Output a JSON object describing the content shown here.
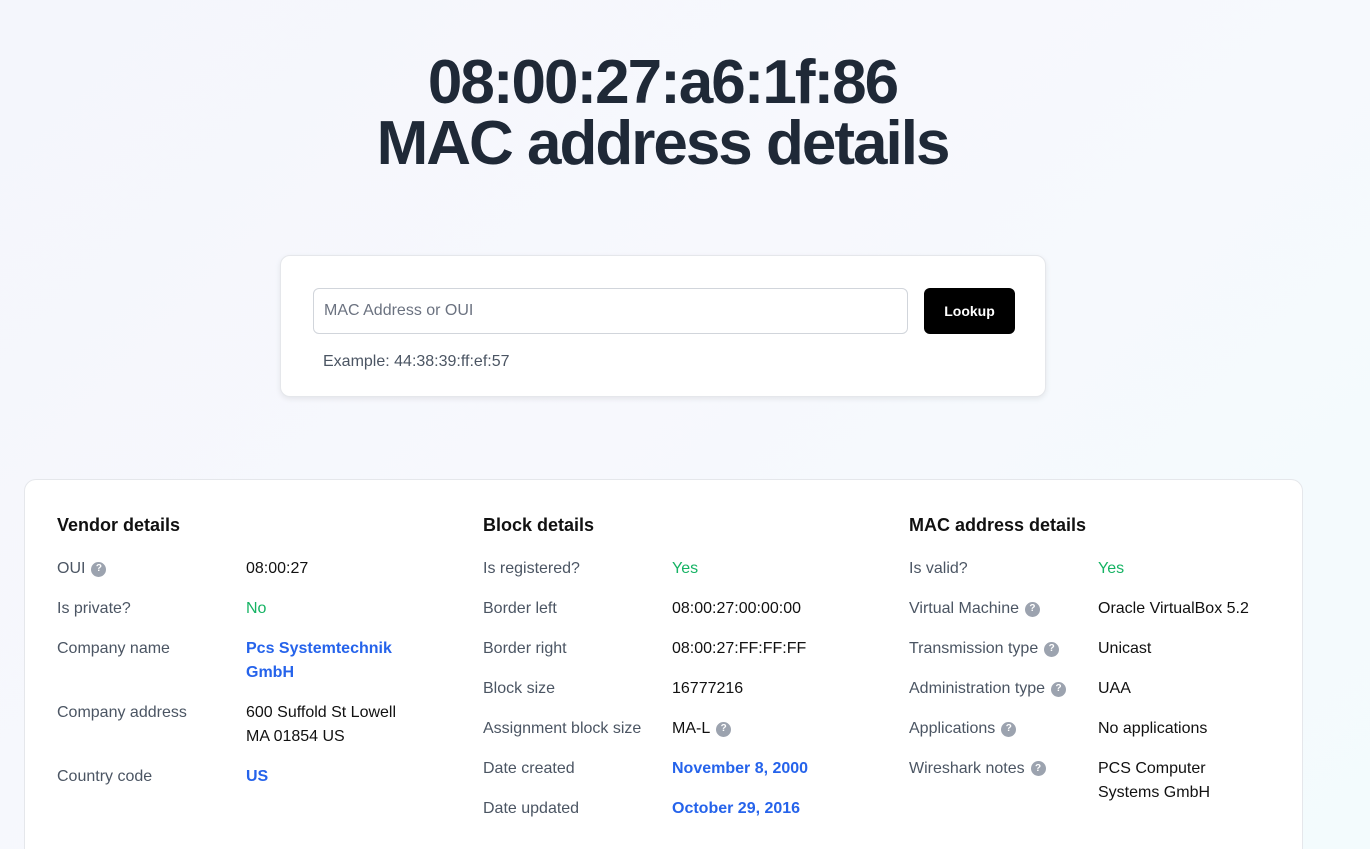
{
  "hero": {
    "line1": "08:00:27:a6:1f:86",
    "line2": "MAC address details"
  },
  "search": {
    "placeholder": "MAC Address or OUI",
    "value": "",
    "button_label": "Lookup",
    "example": "Example: 44:38:39:ff:ef:57"
  },
  "vendor": {
    "title": "Vendor details",
    "oui_label": "OUI",
    "oui_value": "08:00:27",
    "private_label": "Is private?",
    "private_value": "No",
    "company_label": "Company name",
    "company_value": "Pcs Systemtechnik GmbH",
    "address_label": "Company address",
    "address_value": "600 Suffold St Lowell MA 01854 US",
    "country_label": "Country code",
    "country_value": "US"
  },
  "block": {
    "title": "Block details",
    "registered_label": "Is registered?",
    "registered_value": "Yes",
    "border_left_label": "Border left",
    "border_left_value": "08:00:27:00:00:00",
    "border_right_label": "Border right",
    "border_right_value": "08:00:27:FF:FF:FF",
    "size_label": "Block size",
    "size_value": "16777216",
    "assignment_label": "Assignment block size",
    "assignment_value": "MA-L",
    "created_label": "Date created",
    "created_value": "November 8, 2000",
    "updated_label": "Date updated",
    "updated_value": "October 29, 2016"
  },
  "mac": {
    "title": "MAC address details",
    "valid_label": "Is valid?",
    "valid_value": "Yes",
    "vm_label": "Virtual Machine",
    "vm_value": "Oracle VirtualBox 5.2",
    "transmission_label": "Transmission type",
    "transmission_value": "Unicast",
    "admin_label": "Administration type",
    "admin_value": "UAA",
    "applications_label": "Applications",
    "applications_value": "No applications",
    "wireshark_label": "Wireshark notes",
    "wireshark_value": "PCS Computer Systems GmbH"
  },
  "icons": {
    "help": "?"
  },
  "colors": {
    "green": "#16b364",
    "link": "#2563eb",
    "button": "#000000"
  }
}
